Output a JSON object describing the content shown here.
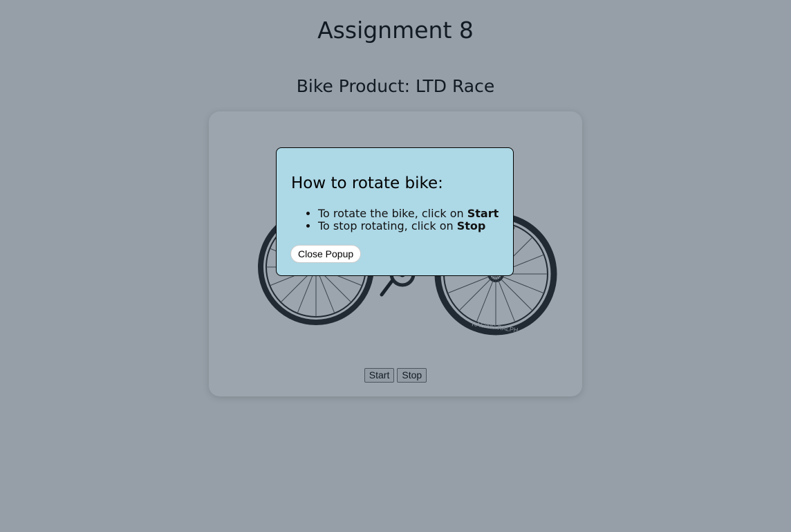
{
  "page": {
    "title": "Assignment 8",
    "product_title": "Bike Product: LTD Race"
  },
  "controls": {
    "start_label": "Start",
    "stop_label": "Stop"
  },
  "popup": {
    "heading": "How to rotate bike:",
    "items": [
      {
        "text": "To rotate the bike, click on ",
        "bold": "Start"
      },
      {
        "text": "To stop rotating, click on ",
        "bold": "Stop"
      }
    ],
    "close_label": "Close Popup"
  },
  "bike": {
    "tire_text": "RACING RALPH"
  },
  "colors": {
    "overlay": "rgba(20,40,60,0.42)",
    "popup_bg": "#add8e6"
  }
}
